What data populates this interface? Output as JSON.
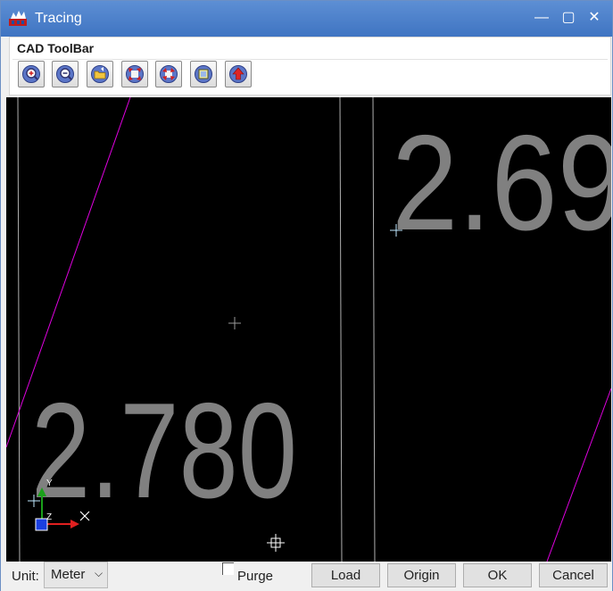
{
  "window": {
    "title": "Tracing"
  },
  "titlebar_buttons": [
    {
      "name": "minimize-button",
      "glyph": "—"
    },
    {
      "name": "maximize-button",
      "glyph": "▢"
    },
    {
      "name": "close-button",
      "glyph": "✕"
    }
  ],
  "toolbar": {
    "title": "CAD ToolBar",
    "tools": [
      {
        "name": "zoom-in-tool",
        "icon": "zoom-in-icon"
      },
      {
        "name": "zoom-out-tool",
        "icon": "zoom-out-icon"
      },
      {
        "name": "open-tool",
        "icon": "folder-icon"
      },
      {
        "name": "zoom-extents-tool",
        "icon": "expand-arrows-icon"
      },
      {
        "name": "zoom-window-tool",
        "icon": "collapse-arrows-icon"
      },
      {
        "name": "pan-tool",
        "icon": "frame-icon"
      },
      {
        "name": "reset-tool",
        "icon": "up-arrow-icon"
      }
    ]
  },
  "canvas": {
    "labels": {
      "left_value": "2.780",
      "right_value": "2.69"
    },
    "ucs_x_label": "X",
    "ucs_y_label": "Y",
    "ucs_z_label": "Z",
    "colors": {
      "background": "#000000",
      "text": "#808080",
      "magenta_line": "#e000e0",
      "grid_line": "#b0b0b0",
      "cursor": "#bfe9ff"
    }
  },
  "bottom": {
    "unit_label": "Unit:",
    "unit_value": "Meter",
    "purge_label": "Purge",
    "purge_checked": false,
    "buttons": {
      "load": "Load",
      "origin": "Origin",
      "ok": "OK",
      "cancel": "Cancel"
    }
  }
}
